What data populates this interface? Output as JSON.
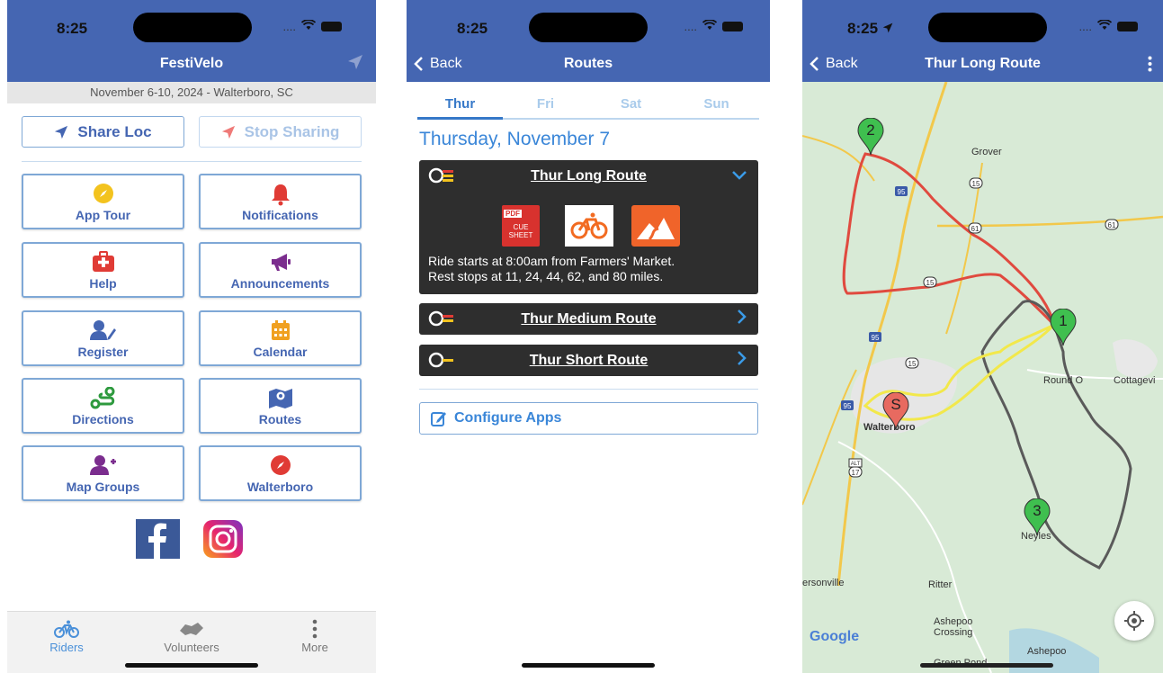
{
  "status": {
    "time": "8:25",
    "dots": "...."
  },
  "phone1": {
    "title": "FestiVelo",
    "date_line": "November 6-10, 2024 - Walterboro, SC",
    "share_label": "Share Loc",
    "stop_label": "Stop Sharing",
    "grid": [
      {
        "label": "App Tour",
        "icon": "compass-icon",
        "color": "#f3c31e"
      },
      {
        "label": "Notifications",
        "icon": "bell-icon",
        "color": "#e03b35"
      },
      {
        "label": "Help",
        "icon": "first-aid-icon",
        "color": "#e03b35"
      },
      {
        "label": "Announcements",
        "icon": "megaphone-icon",
        "color": "#7b2d8e"
      },
      {
        "label": "Register",
        "icon": "user-edit-icon",
        "color": "#4566b2"
      },
      {
        "label": "Calendar",
        "icon": "calendar-icon",
        "color": "#f0a020"
      },
      {
        "label": "Directions",
        "icon": "route-icon",
        "color": "#2e9a3e"
      },
      {
        "label": "Routes",
        "icon": "map-icon",
        "color": "#4566b2"
      },
      {
        "label": "Map Groups",
        "icon": "user-plus-icon",
        "color": "#7b2d8e"
      },
      {
        "label": "Walterboro",
        "icon": "compass-icon",
        "color": "#e03b35"
      }
    ],
    "tabs": [
      {
        "label": "Riders",
        "icon": "bicycle-icon",
        "active": true
      },
      {
        "label": "Volunteers",
        "icon": "handshake-icon",
        "active": false
      },
      {
        "label": "More",
        "icon": "more-icon",
        "active": false
      }
    ]
  },
  "phone2": {
    "back_label": "Back",
    "title": "Routes",
    "day_tabs": [
      "Thur",
      "Fri",
      "Sat",
      "Sun"
    ],
    "day_heading": "Thursday, November 7",
    "routes": [
      {
        "name": "Thur Long Route",
        "expanded": true
      },
      {
        "name": "Thur Medium Route",
        "expanded": false
      },
      {
        "name": "Thur Short Route",
        "expanded": false
      }
    ],
    "cue_pdf": "PDF",
    "cue_sheet": "CUE SHEET",
    "desc_line1": "Ride starts at 8:00am from Farmers' Market.",
    "desc_line2": "Rest stops at 11, 24, 44, 62, and 80 miles.",
    "configure_label": "Configure Apps"
  },
  "phone3": {
    "back_label": "Back",
    "title": "Thur Long Route",
    "markers": [
      "S",
      "1",
      "2",
      "3"
    ],
    "places": [
      "Grover",
      "Round O",
      "Cottagevi",
      "Walterboro",
      "Neyles",
      "ersonville",
      "Ritter",
      "Ashepoo Crossing",
      "Ashepoo",
      "Green Pond"
    ],
    "shields": [
      "95",
      "15",
      "61",
      "61",
      "95",
      "15",
      "95",
      "17",
      "ALT",
      "15",
      "95"
    ],
    "google": "Google"
  }
}
